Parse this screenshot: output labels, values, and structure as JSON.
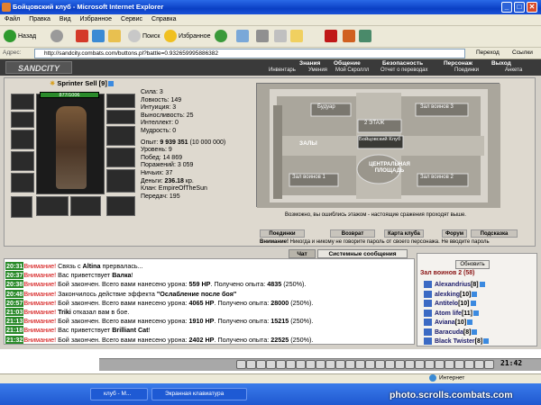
{
  "window": {
    "title": "Бойцовский клуб - Microsoft Internet Explorer",
    "min": "_",
    "max": "□",
    "close": "✕"
  },
  "menu": [
    "Файл",
    "Правка",
    "Вид",
    "Избранное",
    "Сервис",
    "Справка"
  ],
  "toolbar": {
    "back": "Назад",
    "search": "Поиск",
    "favorites": "Избранное"
  },
  "address": {
    "label": "Адрес:",
    "url": "http://sandcity.combats.com/buttons.pl?battle=0.932659995886382",
    "go": "Переход",
    "links": "Ссылки"
  },
  "game": {
    "logo": "SANDCITY",
    "nav_top": [
      "Знания",
      "Общение",
      "Безопасность",
      "Персонаж",
      "Выход"
    ],
    "nav_bottom": [
      "Инвентарь",
      "Умения",
      "Мой Скроллл",
      "Отчет о переводах",
      "Поединки",
      "Анкета"
    ],
    "character": {
      "name": "Sprinter Sell",
      "level": "[9]",
      "hp": "877/1006",
      "stats": [
        "Сила: 3",
        "Ловкость: 149",
        "Интуиция: 3",
        "Выносливость: 25",
        "Интеллект: 0",
        "Мудрость: 0"
      ],
      "info_exp_label": "Опыт:",
      "info_exp_value": "9 939 351",
      "info_exp_next": "(10 000 000)",
      "info": [
        "Уровень: 9",
        "Побед: 14 869",
        "Поражений: 3 059",
        "Ничьих: 37"
      ],
      "money_label": "Деньги:",
      "money_value": "236.18",
      "money_unit": "кр.",
      "clan": "Клан: EmpireOfTheSun",
      "transfers": "Передач: 195"
    },
    "map": {
      "rooms": [
        "Будуар",
        "Зал воинов 3",
        "2 ЭТАЖ",
        "ЗАЛЫ",
        "Бойцовский Клуб",
        "Зал воинов 1",
        "Зал воинов 2",
        "ЦЕНТРАЛЬНАЯ ПЛОЩАДЬ"
      ],
      "note": "Возможно, вы ошиблись этажом - настоящие сражения проходят выше."
    },
    "map_buttons": [
      "Поединки",
      "Возврат",
      "Карта клуба",
      "Форум",
      "Подсказка"
    ],
    "warning_bold": "Внимание!",
    "warning_text": "Никогда и никому не говорите пароль от своего персонажа. Не вводите пароль",
    "chat_tabs": [
      "Чат",
      "Системные сообщения"
    ],
    "chat": [
      {
        "time": "20:31",
        "label": "Внимание!",
        "text_a": " Связь с ",
        "bold": "Altina",
        "text_b": " прервалась..."
      },
      {
        "time": "20:37",
        "label": "Внимание!",
        "text_a": " Вас приветствует ",
        "bold": "Валка",
        "text_b": "!"
      },
      {
        "time": "20:38",
        "label": "Внимание!",
        "text_a": " Бой закончен. Всего вами нанесено урона: ",
        "bold": "559 HP",
        "text_b": ". Получено опыта: ",
        "bold2": "4835",
        "text_c": " (250%)."
      },
      {
        "time": "20:48",
        "label": "Внимание!",
        "text_a": " Закончилось действие эффекта ",
        "bold": "\"Ослабление после боя\"",
        "text_b": ""
      },
      {
        "time": "20:57",
        "label": "Внимание!",
        "text_a": " Бой закончен. Всего вами нанесено урона: ",
        "bold": "4065 HP",
        "text_b": ". Получено опыта: ",
        "bold2": "28000",
        "text_c": " (250%)."
      },
      {
        "time": "21:03",
        "label": "Внимание!",
        "text_a": " ",
        "bold": "Triki",
        "text_b": " отказал вам в бое."
      },
      {
        "time": "21:13",
        "label": "Внимание!",
        "text_a": " Бой закончен. Всего вами нанесено урона: ",
        "bold": "1910 HP",
        "text_b": ". Получено опыта: ",
        "bold2": "15215",
        "text_c": " (250%)."
      },
      {
        "time": "21:18",
        "label": "Внимание!",
        "text_a": " Вас приветствует ",
        "bold": "Brilliant Cat",
        "text_b": "!"
      },
      {
        "time": "21:32",
        "label": "Внимание!",
        "text_a": " Бой закончен. Всего вами нанесено урона: ",
        "bold": "2402 HP",
        "text_b": ". Получено опыта: ",
        "bold2": "22525",
        "text_c": " (250%)."
      }
    ],
    "refresh": "Обновить",
    "room_title": "Зал воинов 2 (58)",
    "players": [
      {
        "name": "Alexandrius",
        "level": "[8]"
      },
      {
        "name": "alexking",
        "level": "[10]"
      },
      {
        "name": "Antitelo",
        "level": "[10]"
      },
      {
        "name": "Atom life",
        "level": "[11]"
      },
      {
        "name": "Aviana",
        "level": "[10]"
      },
      {
        "name": "Baracuda",
        "level": "[8]"
      },
      {
        "name": "Black Twister",
        "level": "[8]"
      }
    ],
    "clock": "21:42"
  },
  "status": {
    "zone": "Интернет"
  },
  "taskbar": {
    "task1": "клуб - М...",
    "task2": "Экранная клавиатура",
    "watermark": "photo.scrolls.combats.com"
  }
}
